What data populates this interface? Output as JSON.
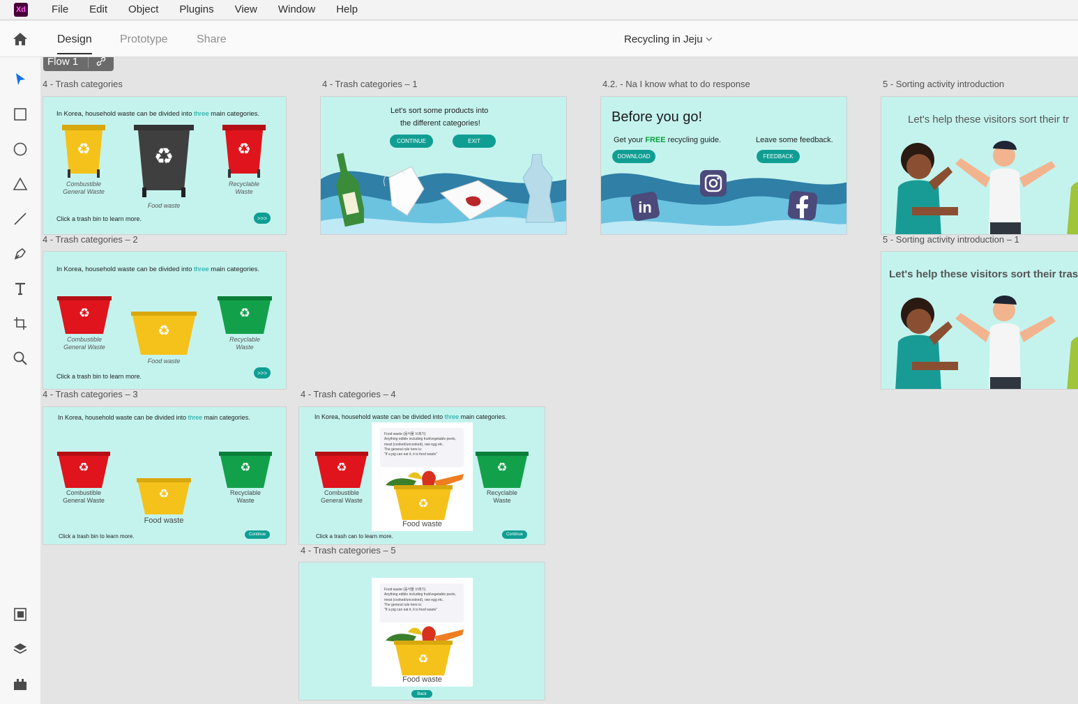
{
  "app": {
    "logo_text": "Xd",
    "menu": [
      "File",
      "Edit",
      "Object",
      "Plugins",
      "View",
      "Window",
      "Help"
    ],
    "tabs": [
      "Design",
      "Prototype",
      "Share"
    ],
    "active_tab": "Design",
    "document_title": "Recycling in Jeju"
  },
  "tools": [
    "select-tool-icon",
    "rectangle-tool-icon",
    "ellipse-tool-icon",
    "polygon-tool-icon",
    "line-tool-icon",
    "pen-tool-icon",
    "text-tool-icon",
    "artboard-tool-icon",
    "zoom-tool-icon",
    "assets-icon",
    "layers-icon",
    "plugins-icon"
  ],
  "flow": {
    "label": "Flow 1"
  },
  "artboards": {
    "ab1": {
      "label": "4 - Trash categories",
      "intro_pre": "In Korea, household waste can be divided into ",
      "intro_hl": "three",
      "intro_post": " main categories.",
      "bin_left": "Combustible\nGeneral Waste",
      "bin_center": "Food waste",
      "bin_right": "Recyclable\nWaste",
      "hint": "Click a trash bin to learn more.",
      "button": ">>>"
    },
    "ab2": {
      "label": "4 - Trash categories – 1",
      "prompt_line1": "Let's sort some products into",
      "prompt_line2": "the different categories!",
      "continue": "CONTINUE",
      "exit": "EXIT"
    },
    "ab3": {
      "label": "4.2. - Na I know what to do response",
      "heading": "Before you go!",
      "guide_pre": "Get your ",
      "guide_hl": "FREE",
      "guide_post": " recycling guide.",
      "download": "DOWNLOAD",
      "feedback_text": "Leave some feedback.",
      "feedback": "FEEDBACK"
    },
    "ab4": {
      "label": "5 - Sorting activity introduction",
      "title": "Let's help these visitors sort their tr"
    },
    "ab5": {
      "label": "4 - Trash categories – 2",
      "intro_pre": "In Korea, household waste can be divided into ",
      "intro_hl": "three",
      "intro_post": " main categories.",
      "bin_left": "Combustible\nGeneral Waste",
      "bin_center": "Food waste",
      "bin_right": "Recyclable\nWaste",
      "hint": "Click a trash bin to learn more.",
      "button": ">>>"
    },
    "ab6": {
      "label": "5 - Sorting activity introduction – 1",
      "title": "Let's help these visitors sort their trash!"
    },
    "ab7": {
      "label": "4 - Trash categories – 3",
      "intro_pre": "In Korea, household waste can be divided into ",
      "intro_hl": "three",
      "intro_post": " main categories.",
      "bin_left": "Combustible\nGeneral Waste",
      "bin_center": "Food waste",
      "bin_right": "Recyclable\nWaste",
      "hint": "Click a trash bin to learn more.",
      "button": "Continue"
    },
    "ab8": {
      "label": "4 - Trash categories – 4",
      "intro_pre": "In Korea, household waste can be divided into ",
      "intro_hl": "three",
      "intro_post": " main categories.",
      "bin_left": "Combustible\nGeneral Waste",
      "bin_center": "Food waste",
      "bin_right": "Recyclable\nWaste",
      "hint": "Click a trash can to learn more.",
      "button": "Continue",
      "note_title": "Food waste (음식물 쓰레기)",
      "note_body": "Anything edible including fruit/vegetable peels, meat (cooked/uncooked), raw egg etc.",
      "note_rule": "The general rule here is:",
      "note_quote": "\"If a pig can eat it, it is food waste\""
    },
    "ab9": {
      "label": "4 - Trash categories – 5",
      "bin_center": "Food waste",
      "button": "Back",
      "note_title": "Food waste (음식물 쓰레기)",
      "note_body": "Anything edible including fruit/vegetable peels, meat (cooked/uncooked), raw egg etc.",
      "note_rule": "The general rule here is:",
      "note_quote": "\"If a pig can eat it, it is food waste\""
    }
  },
  "colors": {
    "artboard_bg": "#c4f3ee",
    "accent": "#109e93",
    "bin_red": "#e0141c",
    "bin_yellow": "#f5c21b",
    "bin_green": "#12a14a",
    "bin_gray": "#3f3f3f"
  }
}
